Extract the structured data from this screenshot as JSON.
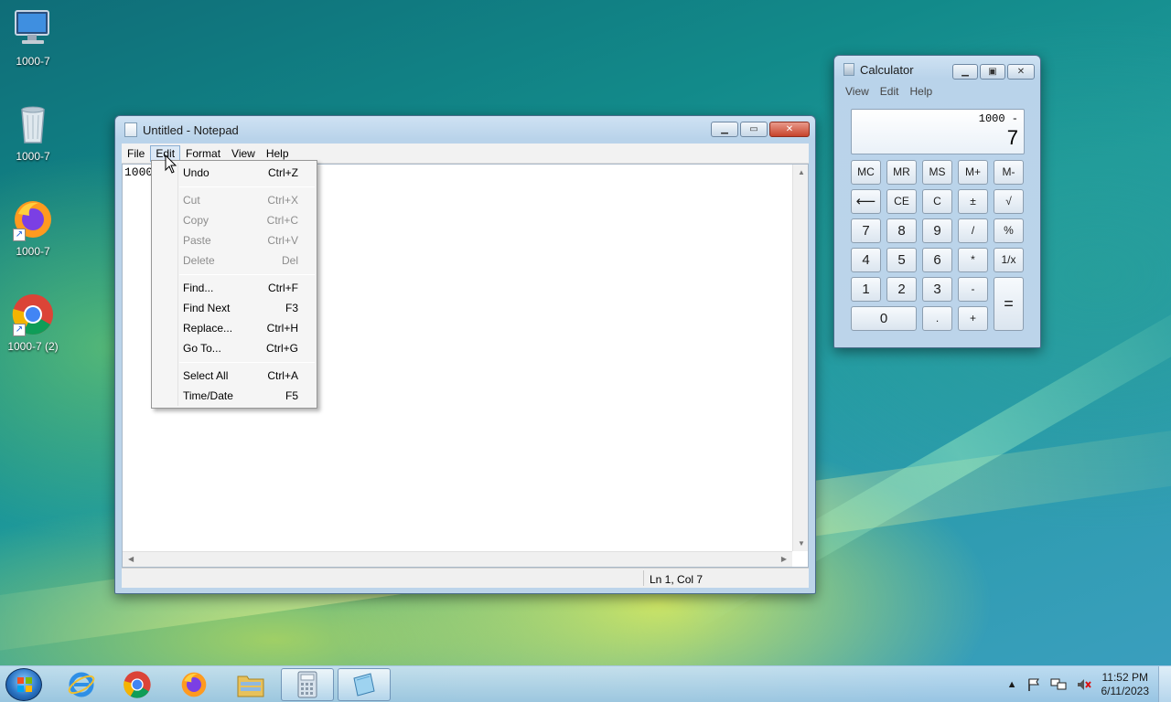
{
  "desktop": {
    "icons": [
      {
        "label": "1000-7",
        "icon": "computer-icon"
      },
      {
        "label": "1000-7",
        "icon": "recycle-bin-icon"
      },
      {
        "label": "1000-7",
        "icon": "firefox-icon"
      },
      {
        "label": "1000-7 (2)",
        "icon": "chrome-icon"
      }
    ]
  },
  "notepad": {
    "title": "Untitled - Notepad",
    "menu": [
      "File",
      "Edit",
      "Format",
      "View",
      "Help"
    ],
    "content": "1000",
    "status": "Ln 1, Col 7"
  },
  "edit_menu": {
    "items": [
      {
        "label": "Undo",
        "shortcut": "Ctrl+Z",
        "enabled": true
      },
      {
        "label": "Cut",
        "shortcut": "Ctrl+X",
        "enabled": false
      },
      {
        "label": "Copy",
        "shortcut": "Ctrl+C",
        "enabled": false
      },
      {
        "label": "Paste",
        "shortcut": "Ctrl+V",
        "enabled": false
      },
      {
        "label": "Delete",
        "shortcut": "Del",
        "enabled": false
      },
      {
        "label": "Find...",
        "shortcut": "Ctrl+F",
        "enabled": true
      },
      {
        "label": "Find Next",
        "shortcut": "F3",
        "enabled": true
      },
      {
        "label": "Replace...",
        "shortcut": "Ctrl+H",
        "enabled": true
      },
      {
        "label": "Go To...",
        "shortcut": "Ctrl+G",
        "enabled": true
      },
      {
        "label": "Select All",
        "shortcut": "Ctrl+A",
        "enabled": true
      },
      {
        "label": "Time/Date",
        "shortcut": "F5",
        "enabled": true
      }
    ]
  },
  "calculator": {
    "title": "Calculator",
    "menu": [
      "View",
      "Edit",
      "Help"
    ],
    "expression": "1000 -",
    "value": "7",
    "buttons": {
      "mc": "MC",
      "mr": "MR",
      "ms": "MS",
      "mplus": "M+",
      "mminus": "M-",
      "back": "⟵",
      "ce": "CE",
      "c": "C",
      "sign": "±",
      "sqrt": "√",
      "n7": "7",
      "n8": "8",
      "n9": "9",
      "div": "/",
      "pct": "%",
      "n4": "4",
      "n5": "5",
      "n6": "6",
      "mul": "*",
      "recip": "1/x",
      "n1": "1",
      "n2": "2",
      "n3": "3",
      "sub": "-",
      "eq": "=",
      "n0": "0",
      "dot": ".",
      "add": "+"
    }
  },
  "taskbar": {
    "time": "11:52 PM",
    "date": "6/11/2023"
  }
}
